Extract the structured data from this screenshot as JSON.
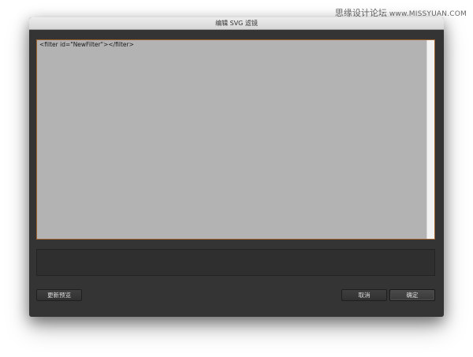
{
  "watermark": {
    "text": "思缘设计论坛",
    "site": "www.MISSYUAN.COM"
  },
  "dialog": {
    "title": "编辑 SVG 滤镜",
    "editor": {
      "content": "<filter id=\"NewFilter\"></filter>"
    },
    "buttons": {
      "update_preview": "更新预览",
      "cancel": "取消",
      "ok": "确定"
    }
  },
  "colors": {
    "dialog_bg": "#343434",
    "editor_bg": "#b3b3b3",
    "focus_border": "#a0622e",
    "titlebar": "#e4e4e4"
  }
}
